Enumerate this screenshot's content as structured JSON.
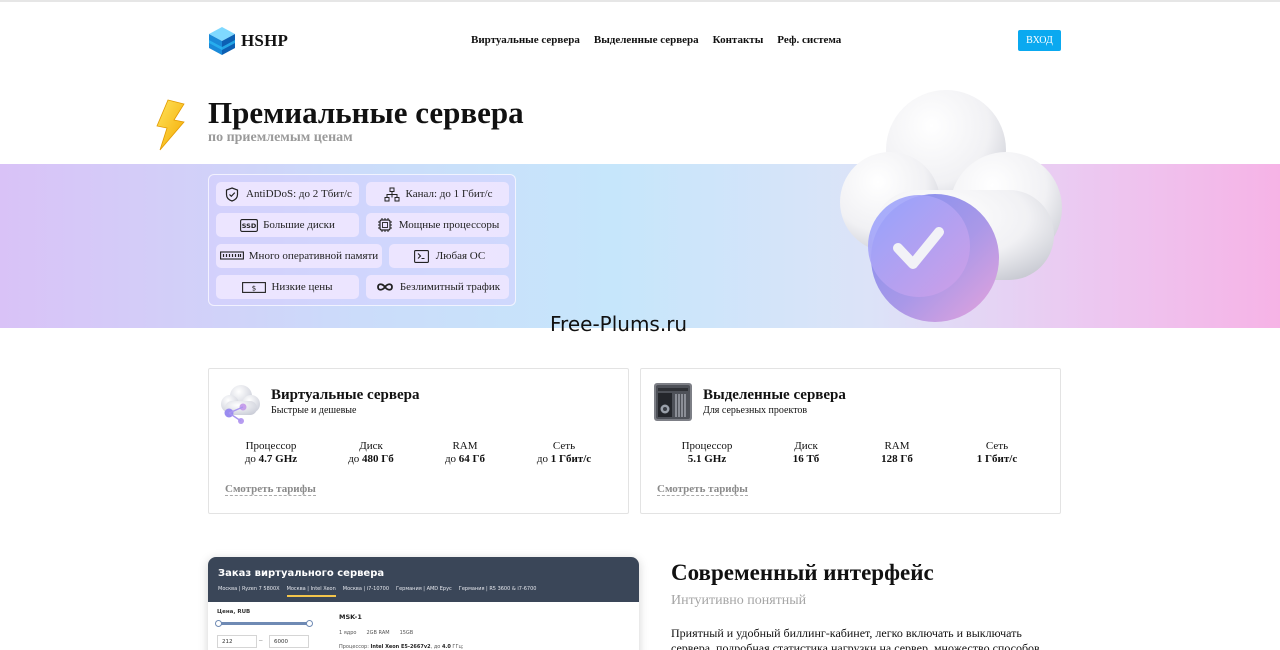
{
  "header": {
    "logo_text": "HSHP",
    "nav": [
      "Виртуальные сервера",
      "Выделенные сервера",
      "Контакты",
      "Реф. система"
    ],
    "login_label": "ВХОД",
    "accent_color": "#0aa9f0"
  },
  "hero": {
    "title": "Премиальные сервера",
    "subtitle": "по приемлемым ценам",
    "features": [
      {
        "icon": "shield-check-icon",
        "label": "AntiDDoS: до 2 Тбит/с"
      },
      {
        "icon": "network-icon",
        "label": "Канал: до 1 Гбит/с"
      },
      {
        "icon": "ssd-icon",
        "label": "Большие диски"
      },
      {
        "icon": "cpu-icon",
        "label": "Мощные процессоры"
      },
      {
        "icon": "ram-icon",
        "label": "Много оперативной памяти"
      },
      {
        "icon": "os-icon",
        "label": "Любая ОС"
      },
      {
        "icon": "dollar-icon",
        "label": "Низкие цены"
      },
      {
        "icon": "infinity-icon",
        "label": "Безлимитный трафик"
      }
    ]
  },
  "watermark": "Free-Plums.ru",
  "cards": [
    {
      "title": "Виртуальные сервера",
      "subtitle": "Быстрые и дешевые",
      "specs": [
        {
          "label": "Процессор",
          "prefix": "до",
          "value": "4.7 GHz"
        },
        {
          "label": "Диск",
          "prefix": "до",
          "value": "480 Гб"
        },
        {
          "label": "RAM",
          "prefix": "до",
          "value": "64 Гб"
        },
        {
          "label": "Сеть",
          "prefix": "до",
          "value": "1 Гбит/с"
        }
      ],
      "link": "Смотреть тарифы"
    },
    {
      "title": "Выделенные сервера",
      "subtitle": "Для серьезных проектов",
      "specs": [
        {
          "label": "Процессор",
          "value": "5.1 GHz"
        },
        {
          "label": "Диск",
          "value": "16 Тб"
        },
        {
          "label": "RAM",
          "value": "128 Гб"
        },
        {
          "label": "Сеть",
          "value": "1 Гбит/с"
        }
      ],
      "link": "Смотреть тарифы"
    }
  ],
  "panel": {
    "title": "Заказ виртуального сервера",
    "tabs": [
      "Москва | Ryzen 7 5800X",
      "Москва | Intel Xeon",
      "Москва | i7-10700",
      "Германия | AMD Epyc",
      "Германия | R5 3600 & i7-6700"
    ],
    "active_tab": 1,
    "price_label": "Цена, RUB",
    "price_min": "212",
    "price_max": "6000",
    "server": {
      "name": "MSK-1",
      "cores": "1 ядро",
      "ram": "2GB RAM",
      "disk": "15GB",
      "cpu_prefix": "Процессор:",
      "cpu": "Intel Xeon E5-2667v2",
      "cpu_freq_prefix": "до",
      "cpu_freq": "4.0",
      "cpu_freq_unit": "ГГц;"
    }
  },
  "modern": {
    "title": "Современный интерфейс",
    "subtitle": "Интуитивно понятный",
    "text": "Приятный и удобный биллинг-кабинет, легко включать и выключать сервера, подробная статистика нагрузки на сервер, множество способов"
  }
}
